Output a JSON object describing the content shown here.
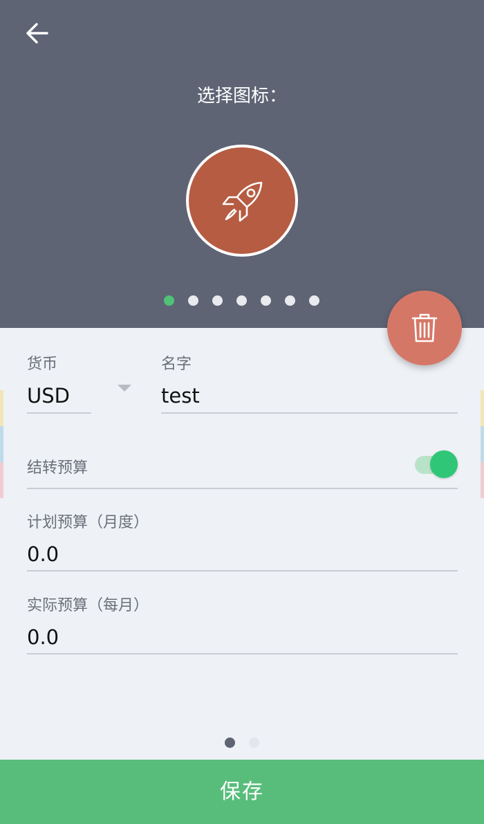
{
  "header": {
    "back_icon": "arrow-left-icon",
    "title": "选择图标：",
    "selected_icon": "rocket-icon",
    "selected_icon_color": "#b65c42",
    "icon_page_count": 7,
    "icon_page_active": 1,
    "background_color": "#5e6474"
  },
  "fab": {
    "icon": "trash-icon",
    "color": "#d57767"
  },
  "form": {
    "currency": {
      "label": "货币",
      "value": "USD"
    },
    "name": {
      "label": "名字",
      "value": "test"
    },
    "rollover": {
      "label": "结转预算",
      "enabled": true
    },
    "planned_budget": {
      "label": "计划预算（月度）",
      "value": "0.0"
    },
    "actual_budget": {
      "label": "实际预算（每月）",
      "value": "0.0"
    }
  },
  "pager": {
    "page_count": 2,
    "active": 1
  },
  "save_button": {
    "label": "保存",
    "color": "#58bd7b"
  },
  "accent_colors": {
    "toggle_on": "#2fc777",
    "active_dot": "#4fc277"
  }
}
